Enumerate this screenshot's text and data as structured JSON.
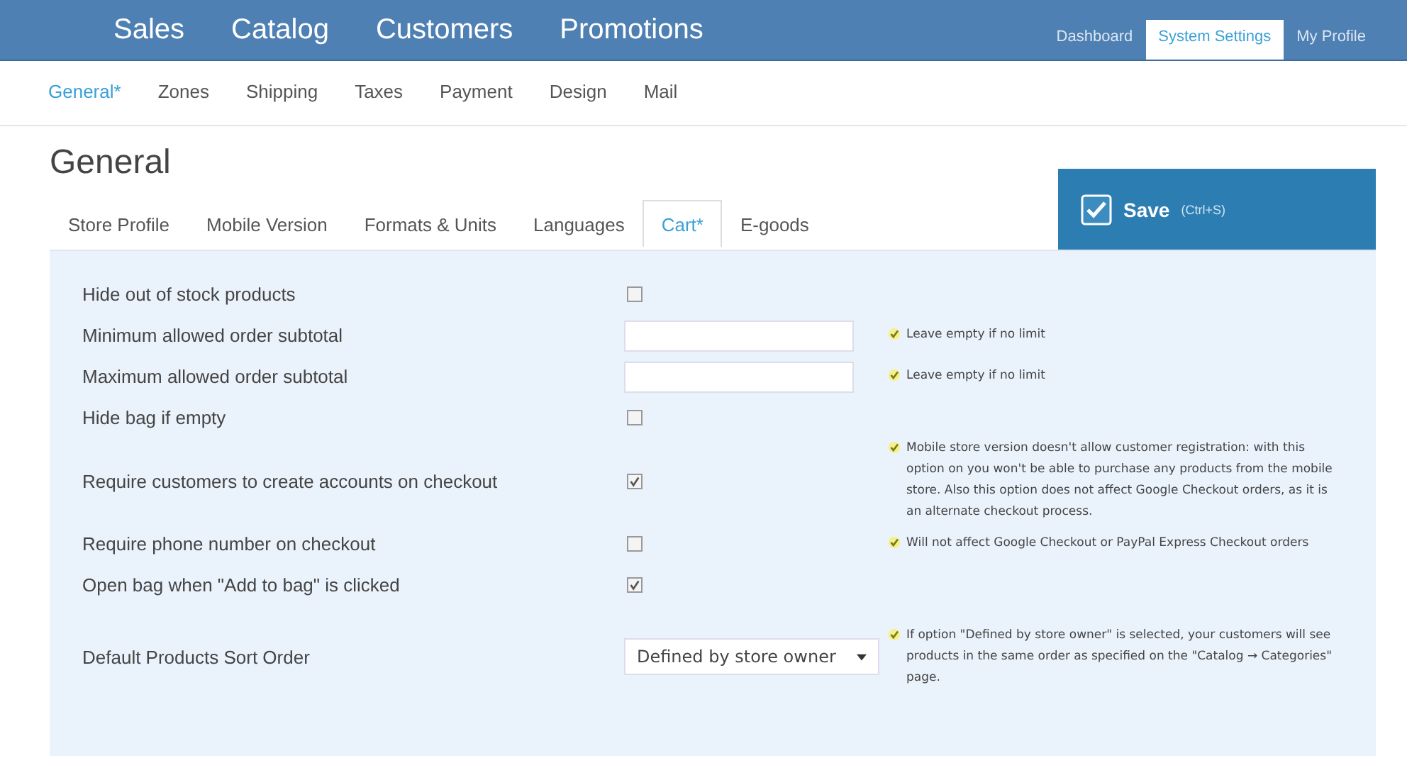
{
  "top_nav": [
    {
      "label": "Sales"
    },
    {
      "label": "Catalog"
    },
    {
      "label": "Customers"
    },
    {
      "label": "Promotions"
    }
  ],
  "right_tabs": [
    {
      "label": "Dashboard",
      "selected": false
    },
    {
      "label": "System Settings",
      "selected": true
    },
    {
      "label": "My Profile",
      "selected": false
    }
  ],
  "sub_nav": [
    {
      "label": "General*",
      "selected": true
    },
    {
      "label": "Zones",
      "selected": false
    },
    {
      "label": "Shipping",
      "selected": false
    },
    {
      "label": "Taxes",
      "selected": false
    },
    {
      "label": "Payment",
      "selected": false
    },
    {
      "label": "Design",
      "selected": false
    },
    {
      "label": "Mail",
      "selected": false
    }
  ],
  "page_title": "General",
  "tabs": [
    {
      "label": "Store Profile",
      "selected": false
    },
    {
      "label": "Mobile Version",
      "selected": false
    },
    {
      "label": "Formats & Units",
      "selected": false
    },
    {
      "label": "Languages",
      "selected": false
    },
    {
      "label": "Cart*",
      "selected": true
    },
    {
      "label": "E-goods",
      "selected": false
    }
  ],
  "save_button": {
    "label": "Save",
    "shortcut": "(Ctrl+S)"
  },
  "settings": [
    {
      "kind": "checkbox",
      "label": "Hide out of stock products",
      "checked": false
    },
    {
      "kind": "text",
      "label": "Minimum allowed order subtotal",
      "hint": "Leave empty if no limit"
    },
    {
      "kind": "text",
      "label": "Maximum allowed order subtotal",
      "hint": "Leave empty if no limit"
    },
    {
      "kind": "checkbox",
      "label": "Hide bag if empty",
      "checked": false
    },
    {
      "kind": "checkbox",
      "label": "Require customers to create accounts on checkout",
      "checked": true,
      "hint": "Mobile store version doesn't allow customer registration: with this option on you won't be able to purchase any products from the mobile store. Also this option does not affect Google Checkout orders, as it is an alternate checkout process."
    },
    {
      "kind": "checkbox",
      "label": "Require phone number on checkout",
      "checked": false,
      "hint": "Will not affect Google Checkout or PayPal Express Checkout orders"
    },
    {
      "kind": "checkbox",
      "label": "Open bag when \"Add to bag\" is clicked",
      "checked": true
    },
    {
      "kind": "select",
      "label": "Default Products Sort Order",
      "value": "Defined by store owner",
      "hint": "If option \"Defined by store owner\" is selected, your customers will see products in the same order as specified on the \"Catalog → Categories\" page."
    }
  ]
}
